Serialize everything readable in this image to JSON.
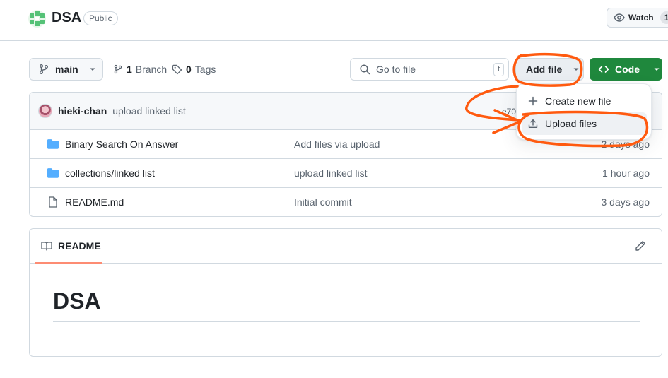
{
  "repo": {
    "name": "DSA",
    "visibility": "Public",
    "watch_label": "Watch",
    "watch_count": "1"
  },
  "toolbar": {
    "branch": "main",
    "branch_count": "1",
    "branch_word": "Branch",
    "tag_count": "0",
    "tag_word": "Tags",
    "goto_placeholder": "Go to file",
    "goto_shortcut": "t",
    "add_file_label": "Add file",
    "code_label": "Code"
  },
  "add_file_menu": {
    "items": [
      {
        "label": "Create new file",
        "icon": "plus-icon"
      },
      {
        "label": "Upload files",
        "icon": "upload-icon"
      }
    ]
  },
  "latest_commit": {
    "author": "hieki-chan",
    "message": "upload linked list",
    "hash": "e70"
  },
  "files": [
    {
      "name": "Binary Search On Answer",
      "type": "folder",
      "commit": "Add files via upload",
      "time": "2 days ago"
    },
    {
      "name": "collections/linked list",
      "type": "folder",
      "commit": "upload linked list",
      "time": "1 hour ago"
    },
    {
      "name": "README.md",
      "type": "file",
      "commit": "Initial commit",
      "time": "3 days ago"
    }
  ],
  "readme": {
    "tab_label": "README",
    "heading": "DSA"
  },
  "colors": {
    "code_button": "#1f883d",
    "folder": "#54aeff",
    "annotation": "#ff5a0f",
    "tab_underline": "#fd8c73"
  }
}
